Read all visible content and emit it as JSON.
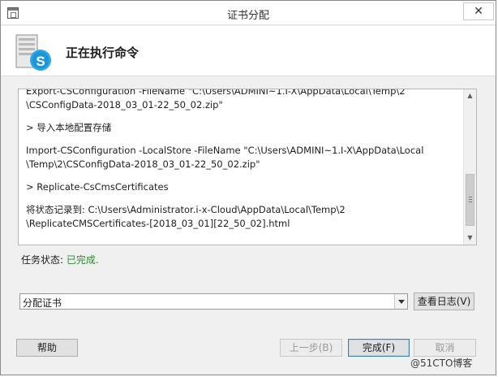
{
  "window": {
    "title": "证书分配",
    "close_glyph": "✕"
  },
  "header": {
    "title": "正在执行命令",
    "icon": "server-skype-icon"
  },
  "log": {
    "lines": [
      "Export-CSConfiguration -FileName \"C:\\Users\\ADMINI~1.I-X\\AppData\\Local\\Temp\\2",
      "\\CSConfigData-2018_03_01-22_50_02.zip\"",
      "> 导入本地配置存储",
      "Import-CSConfiguration -LocalStore -FileName \"C:\\Users\\ADMINI~1.I-X\\AppData\\Local",
      "\\Temp\\2\\CSConfigData-2018_03_01-22_50_02.zip\"",
      "> Replicate-CsCmsCertificates",
      "将状态记录到: C:\\Users\\Administrator.i-x-Cloud\\AppData\\Local\\Temp\\2",
      "\\ReplicateCMSCertificates-[2018_03_01][22_50_02].html"
    ]
  },
  "status": {
    "label": "任务状态: ",
    "value": "已完成.",
    "value_color": "#2a8a2a"
  },
  "dropdown": {
    "selected": "分配证书"
  },
  "buttons": {
    "view_log": "查看日志(V)",
    "help": "帮助",
    "prev": "上一步(B)",
    "finish": "完成(F)",
    "cancel": "取消"
  },
  "watermark": "@51CTO博客"
}
